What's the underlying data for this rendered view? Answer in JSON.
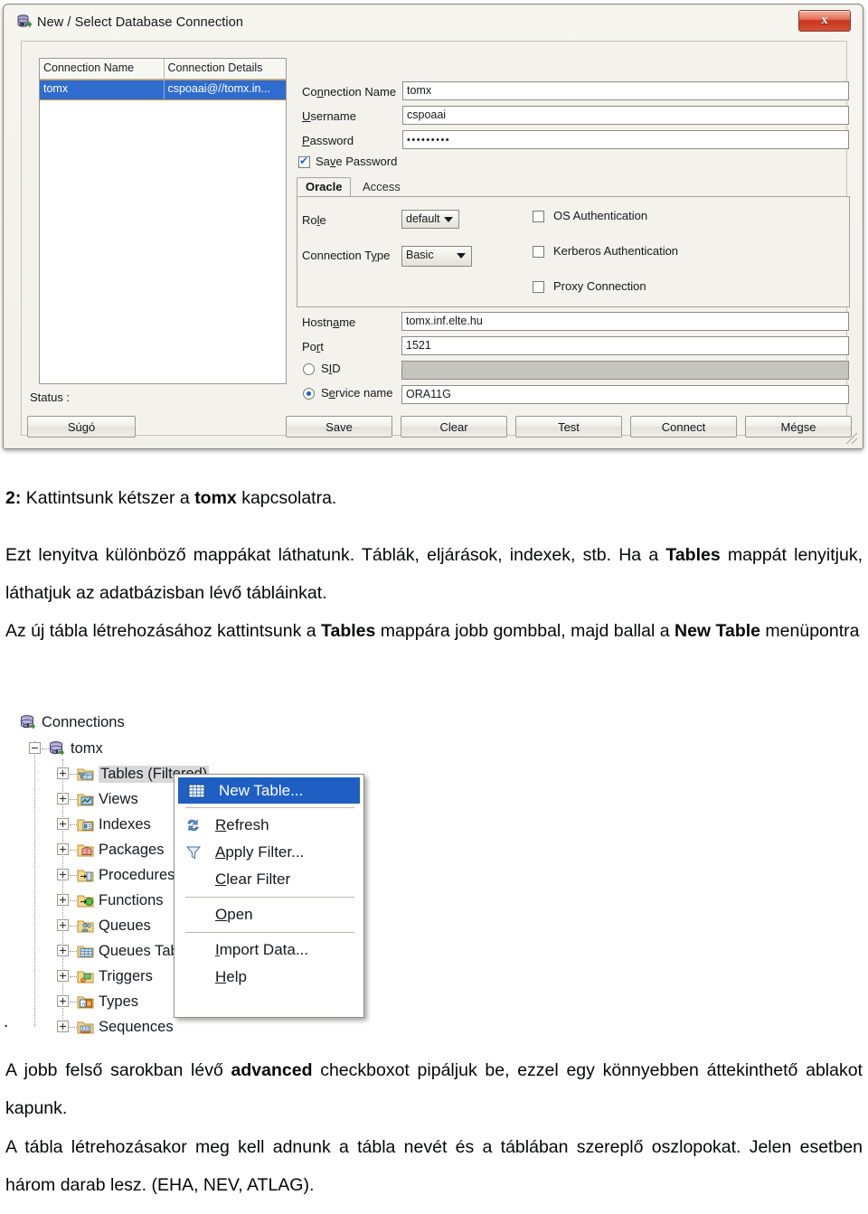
{
  "dialog": {
    "title": "New / Select Database Connection",
    "title_icon": "database-icon",
    "close_label": "x",
    "list": {
      "headers": [
        "Connection Name",
        "Connection Details"
      ],
      "rows": [
        {
          "name": "tomx",
          "details": "cspoaai@//tomx.in..."
        }
      ]
    },
    "fields": {
      "connection_name_label": "Connection Name",
      "connection_name_value": "tomx",
      "username_label": "Username",
      "username_value": "cspoaai",
      "password_label": "Password",
      "password_value": "•••••••••",
      "save_password_label": "Save Password",
      "save_password_checked": true
    },
    "tabs": [
      {
        "label": "Oracle",
        "active": true
      },
      {
        "label": "Access",
        "active": false
      }
    ],
    "oracle": {
      "role_label": "Role",
      "role_value": "default",
      "connection_type_label": "Connection Type",
      "connection_type_value": "Basic",
      "os_auth_label": "OS Authentication",
      "os_auth_checked": false,
      "kerberos_label": "Kerberos Authentication",
      "kerberos_checked": false,
      "proxy_label": "Proxy Connection",
      "proxy_checked": false
    },
    "connect_details": {
      "hostname_label": "Hostname",
      "hostname_value": "tomx.inf.elte.hu",
      "port_label": "Port",
      "port_value": "1521",
      "sid_label": "SID",
      "sid_value": "",
      "sid_selected": false,
      "service_name_label": "Service name",
      "service_name_value": "ORA11G",
      "service_name_selected": true
    },
    "status_label": "Status :",
    "buttons": [
      {
        "label": "Súgó"
      },
      {
        "label": "Save"
      },
      {
        "label": "Clear"
      },
      {
        "label": "Test"
      },
      {
        "label": "Connect"
      },
      {
        "label": "Mégse"
      }
    ]
  },
  "body_text": {
    "p1_prefix": "2: ",
    "p1": "Kattintsunk kétszer a ",
    "p1_bold": "tomx",
    "p1_suffix": " kapcsolatra.",
    "p2_a": "Ezt lenyitva különböző mappákat láthatunk. Táblák, eljárások, indexek, stb. Ha a ",
    "p2_bold": "Tables",
    "p2_b": " mappát lenyitjuk, láthatjuk az adatbázisban lévő tábláinkat.",
    "p3_a": "Az új tábla létrehozásához kattintsunk a ",
    "p3_bold1": "Tables",
    "p3_b": " mappára jobb gombbal, majd ballal a ",
    "p3_bold2": "New Table",
    "p3_c": " menüpontra",
    "p4_a": "A jobb felső sarokban lévő ",
    "p4_bold": "advanced",
    "p4_b": " checkboxot pipáljuk be, ezzel egy könnyebben áttekinthető ablakot kapunk.",
    "p5": "A tábla létrehozásakor meg kell adnunk a tábla nevét és a táblában szereplő oszlopokat. Jelen esetben három darab lesz. (EHA, NEV, ATLAG).",
    "stray_period": "."
  },
  "tree": {
    "nodes": [
      {
        "label": "Connections",
        "icon": "database-icon",
        "depth": 0,
        "expander": "none",
        "selected": false
      },
      {
        "label": "tomx",
        "icon": "database-icon",
        "depth": 1,
        "expander": "minus",
        "selected": false
      },
      {
        "label": "Tables (Filtered)",
        "icon": "folder-table-icon",
        "depth": 2,
        "expander": "plus",
        "selected": true
      },
      {
        "label": "Views",
        "icon": "folder-view-icon",
        "depth": 2,
        "expander": "plus",
        "selected": false
      },
      {
        "label": "Indexes",
        "icon": "folder-index-icon",
        "depth": 2,
        "expander": "plus",
        "selected": false
      },
      {
        "label": "Packages",
        "icon": "folder-package-icon",
        "depth": 2,
        "expander": "plus",
        "selected": false
      },
      {
        "label": "Procedures",
        "icon": "folder-procedure-icon",
        "depth": 2,
        "expander": "plus",
        "selected": false
      },
      {
        "label": "Functions",
        "icon": "folder-function-icon",
        "depth": 2,
        "expander": "plus",
        "selected": false
      },
      {
        "label": "Queues",
        "icon": "folder-queue-icon",
        "depth": 2,
        "expander": "plus",
        "selected": false
      },
      {
        "label": "Queues Tables",
        "icon": "folder-queue-table-icon",
        "depth": 2,
        "expander": "plus",
        "selected": false
      },
      {
        "label": "Triggers",
        "icon": "folder-trigger-icon",
        "depth": 2,
        "expander": "plus",
        "selected": false
      },
      {
        "label": "Types",
        "icon": "folder-type-icon",
        "depth": 2,
        "expander": "plus",
        "selected": false
      },
      {
        "label": "Sequences",
        "icon": "folder-sequence-icon",
        "depth": 2,
        "expander": "plus",
        "selected": false
      }
    ]
  },
  "context_menu": {
    "items": [
      {
        "label": "New Table...",
        "icon": "grid-icon",
        "highlighted": true,
        "separator_after": true
      },
      {
        "label": "Refresh",
        "icon": "refresh-icon",
        "highlighted": false,
        "separator_after": false
      },
      {
        "label": "Apply Filter...",
        "icon": "funnel-icon",
        "highlighted": false,
        "separator_after": false
      },
      {
        "label": "Clear Filter",
        "icon": "",
        "highlighted": false,
        "separator_after": true
      },
      {
        "label": "Open",
        "icon": "",
        "highlighted": false,
        "separator_after": true
      },
      {
        "label": "Import Data...",
        "icon": "",
        "highlighted": false,
        "separator_after": false
      },
      {
        "label": "Help",
        "icon": "",
        "highlighted": false,
        "separator_after": false
      }
    ]
  },
  "colors": {
    "selection_blue": "#2f6cce",
    "menu_highlight": "#1f5fc4",
    "close_red": "#c9341c",
    "dialog_bg": "#f3f2ec"
  }
}
